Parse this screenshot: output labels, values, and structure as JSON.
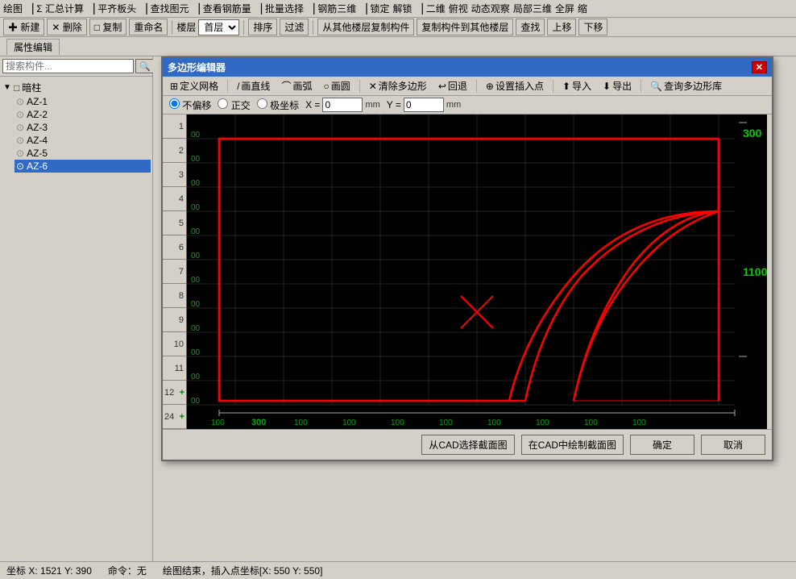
{
  "app": {
    "title": "多边形编辑器"
  },
  "top_toolbar": {
    "items": [
      "绘图",
      "Σ 汇总计算",
      "平齐板头",
      "查找图元",
      "查看钢筋量",
      "批量选择",
      "钢筋三维",
      "锁定",
      "解锁",
      "二维",
      "俯视",
      "动态观察",
      "局部三维",
      "全屏",
      "缩"
    ]
  },
  "second_toolbar": {
    "new_label": "✚ 新建",
    "del_label": "✕ 删除",
    "copy_label": "□ 复制",
    "rename_label": "重命名",
    "floor_label": "楼层",
    "floor_value": "首层",
    "sort_label": "排序",
    "filter_label": "过滤",
    "copy_from_label": "从其他楼层复制构件",
    "copy_to_label": "复制构件到其他楼层",
    "find_label": "查找",
    "up_label": "上移",
    "down_label": "下移"
  },
  "properties_tab": {
    "label": "属性编辑"
  },
  "search": {
    "placeholder": "搜索构件...",
    "btn_label": "🔍"
  },
  "tree": {
    "root_label": "暗柱",
    "items": [
      {
        "id": "AZ-1",
        "label": "AZ-1",
        "selected": false
      },
      {
        "id": "AZ-2",
        "label": "AZ-2",
        "selected": false
      },
      {
        "id": "AZ-3",
        "label": "AZ-3",
        "selected": false
      },
      {
        "id": "AZ-4",
        "label": "AZ-4",
        "selected": false
      },
      {
        "id": "AZ-5",
        "label": "AZ-5",
        "selected": false
      },
      {
        "id": "AZ-6",
        "label": "AZ-6",
        "selected": true
      }
    ]
  },
  "dialog": {
    "title": "多边形编辑器",
    "close_label": "✕",
    "toolbar": {
      "grid_label": "定义网格",
      "line_label": "画直线",
      "arc_label": "画弧",
      "circle_label": "画圆",
      "clear_label": "清除多边形",
      "undo_label": "回退",
      "setpoint_label": "设置插入点",
      "import_label": "导入",
      "export_label": "导出",
      "query_label": "查询多边形库"
    },
    "coord_bar": {
      "no_offset": "不偏移",
      "orthogonal": "正交",
      "polar": "极坐标",
      "x_label": "X =",
      "y_label": "Y =",
      "unit": "mm"
    },
    "row_numbers": [
      "1",
      "2",
      "3",
      "4",
      "5",
      "6",
      "7",
      "8",
      "9",
      "10",
      "11",
      "12",
      "24"
    ],
    "row_add": [
      "+",
      "+"
    ],
    "canvas": {
      "grid_labels_right": [
        "300",
        "",
        "1100"
      ],
      "grid_labels_bottom": [
        "100",
        "300",
        "100",
        "100",
        "100",
        "100",
        "100",
        "100",
        "100",
        "100"
      ],
      "dimension_300": "300",
      "dimension_1100": "1100"
    },
    "bottom": {
      "from_cad_label": "从CAD选择截面图",
      "draw_cad_label": "在CAD中绘制截面图",
      "confirm_label": "确定",
      "cancel_label": "取消"
    }
  },
  "status_bar": {
    "coord_label": "坐标",
    "x_val": "1521",
    "y_val": "390",
    "cmd_label": "命令：无",
    "draw_end": "绘图结束，插入点坐标[X: 550 Y: 550]"
  }
}
